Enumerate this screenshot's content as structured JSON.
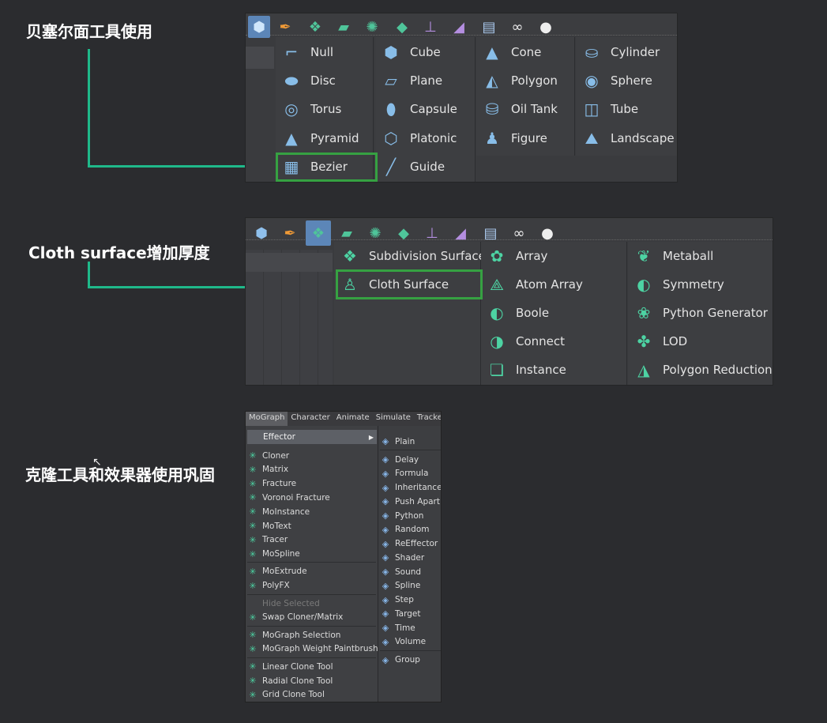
{
  "captions": {
    "bezier": "贝塞尔面工具使用",
    "cloth": "Cloth surface增加厚度",
    "clone": "克隆工具和效果器使用巩固"
  },
  "colors": {
    "background": "#2b2c2f",
    "connector": "#1fb98a",
    "highlight_box": "#36a142",
    "icon_blue": "#88bde8",
    "icon_green": "#4dd3a3"
  },
  "panel1": {
    "toolbar_icons": [
      "cube-icon",
      "pen-icon",
      "subdivision-icon",
      "extrude-icon",
      "mograph-icon",
      "deformer-icon",
      "scene-icon",
      "camera-icon",
      "floor-icon",
      "glasses-icon",
      "light-icon"
    ],
    "columns": [
      [
        {
          "label": "Null",
          "icon": "null-icon"
        },
        {
          "label": "Disc",
          "icon": "disc-icon"
        },
        {
          "label": "Torus",
          "icon": "torus-icon"
        },
        {
          "label": "Pyramid",
          "icon": "pyramid-icon"
        },
        {
          "label": "Bezier",
          "icon": "bezier-icon"
        }
      ],
      [
        {
          "label": "Cube",
          "icon": "cube-icon"
        },
        {
          "label": "Plane",
          "icon": "plane-icon"
        },
        {
          "label": "Capsule",
          "icon": "capsule-icon"
        },
        {
          "label": "Platonic",
          "icon": "platonic-icon"
        },
        {
          "label": "Guide",
          "icon": "guide-icon"
        }
      ],
      [
        {
          "label": "Cone",
          "icon": "cone-icon"
        },
        {
          "label": "Polygon",
          "icon": "polygon-icon"
        },
        {
          "label": "Oil Tank",
          "icon": "oil-tank-icon"
        },
        {
          "label": "Figure",
          "icon": "figure-icon"
        }
      ],
      [
        {
          "label": "Cylinder",
          "icon": "cylinder-icon"
        },
        {
          "label": "Sphere",
          "icon": "sphere-icon"
        },
        {
          "label": "Tube",
          "icon": "tube-icon"
        },
        {
          "label": "Landscape",
          "icon": "landscape-icon"
        }
      ]
    ]
  },
  "panel2": {
    "columns": [
      [
        {
          "label": "Subdivision Surface",
          "icon": "subdivision-surface-icon"
        },
        {
          "label": "Cloth Surface",
          "icon": "cloth-surface-icon"
        }
      ],
      [
        {
          "label": "Array",
          "icon": "array-icon"
        },
        {
          "label": "Atom Array",
          "icon": "atom-array-icon"
        },
        {
          "label": "Boole",
          "icon": "boole-icon"
        },
        {
          "label": "Connect",
          "icon": "connect-icon"
        },
        {
          "label": "Instance",
          "icon": "instance-icon"
        }
      ],
      [
        {
          "label": "Metaball",
          "icon": "metaball-icon"
        },
        {
          "label": "Symmetry",
          "icon": "symmetry-icon"
        },
        {
          "label": "Python Generator",
          "icon": "python-generator-icon"
        },
        {
          "label": "LOD",
          "icon": "lod-icon"
        },
        {
          "label": "Polygon Reduction",
          "icon": "polygon-reduction-icon"
        }
      ]
    ]
  },
  "mograph": {
    "tabs": [
      "MoGraph",
      "Character",
      "Animate",
      "Simulate",
      "Tracker"
    ],
    "effector_label": "Effector",
    "left_groups": [
      [
        "Cloner",
        "Matrix",
        "Fracture",
        "Voronoi Fracture",
        "MoInstance",
        "MoText",
        "Tracer",
        "MoSpline"
      ],
      [
        "MoExtrude",
        "PolyFX"
      ],
      [
        "Hide Selected",
        "Swap Cloner/Matrix"
      ],
      [
        "MoGraph Selection",
        "MoGraph Weight Paintbrush"
      ],
      [
        "Linear Clone Tool",
        "Radial Clone Tool",
        "Grid Clone Tool"
      ]
    ],
    "right_top": "Plain",
    "right_items": [
      "Delay",
      "Formula",
      "Inheritance",
      "Push Apart",
      "Python",
      "Random",
      "ReEffector",
      "Shader",
      "Sound",
      "Spline",
      "Step",
      "Target",
      "Time",
      "Volume"
    ],
    "right_bottom": "Group"
  }
}
